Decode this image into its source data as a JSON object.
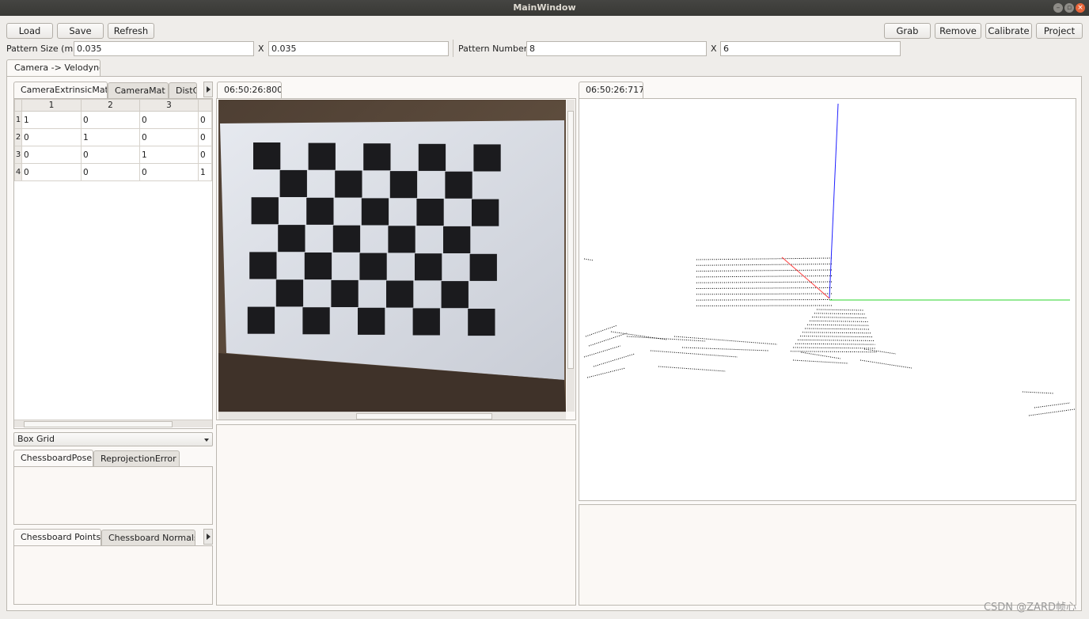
{
  "window": {
    "title": "MainWindow"
  },
  "toolbar": {
    "load": "Load",
    "save": "Save",
    "refresh": "Refresh",
    "grab": "Grab",
    "remove": "Remove",
    "calibrate": "Calibrate",
    "project": "Project"
  },
  "pattern": {
    "size_label": "Pattern Size (m)",
    "size_x": "0.035",
    "x_sep": "X",
    "size_y": "0.035",
    "number_label": "Pattern Number",
    "number_x": "8",
    "number_y": "6"
  },
  "main_tab": "Camera -> Velodyne",
  "matrix_tabs": [
    "CameraExtrinsicMat",
    "CameraMat",
    "DistC"
  ],
  "matrix": {
    "columns": [
      "1",
      "2",
      "3",
      ""
    ],
    "rows": [
      {
        "h": "1",
        "c": [
          "1",
          "0",
          "0",
          "0"
        ]
      },
      {
        "h": "2",
        "c": [
          "0",
          "1",
          "0",
          "0"
        ]
      },
      {
        "h": "3",
        "c": [
          "0",
          "0",
          "1",
          "0"
        ]
      },
      {
        "h": "4",
        "c": [
          "0",
          "0",
          "0",
          "1"
        ]
      }
    ]
  },
  "box_mode": "Box Grid",
  "pose_tabs": [
    "ChessboardPose",
    "ReprojectionError"
  ],
  "points_tabs": [
    "Chessboard Points",
    "Chessboard Normals"
  ],
  "camera_view": {
    "timestamp": "06:50:26:800"
  },
  "lidar_view": {
    "timestamp": "06:50:26:717"
  },
  "colors": {
    "x_axis": "#ff3b3b",
    "y_axis": "#2bd62b",
    "z_axis": "#2020ff"
  },
  "watermark": "CSDN @ZARD帧心"
}
